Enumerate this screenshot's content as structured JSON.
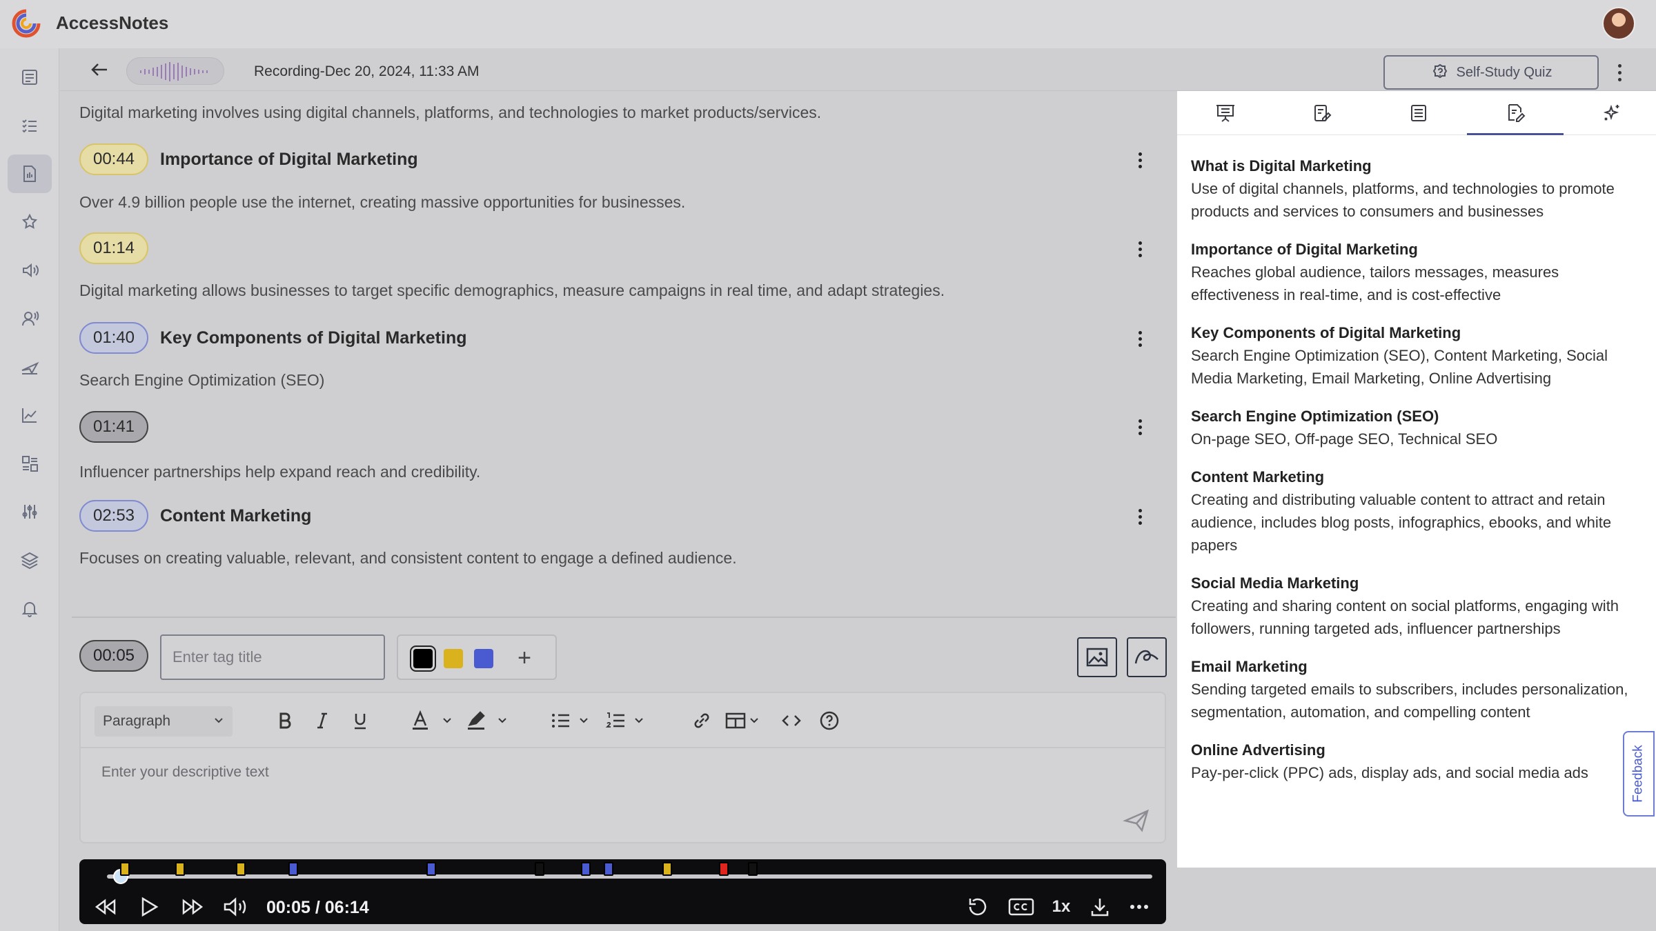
{
  "app": {
    "title": "AccessNotes"
  },
  "header": {
    "recording_title": "Recording-Dec 20, 2024, 11:33 AM",
    "quiz_button": "Self-Study Quiz"
  },
  "rail": {
    "items": [
      "notes-icon",
      "checklist-icon",
      "document-audio-icon",
      "star-icon",
      "speaker-icon",
      "voice-icon",
      "paper-plane-icon",
      "chart-line-icon",
      "layout-icon",
      "sliders-icon",
      "layers-icon",
      "bell-icon"
    ],
    "active_index": 2
  },
  "transcript": {
    "intro": "Digital marketing involves using digital channels, platforms, and technologies to market products/services.",
    "segments": [
      {
        "time": "00:44",
        "color": "yellow",
        "heading": "Importance of Digital Marketing",
        "text": "Over 4.9 billion people use the internet, creating massive opportunities for businesses."
      },
      {
        "time": "01:14",
        "color": "yellow",
        "heading": "",
        "text": "Digital marketing allows businesses to target specific demographics, measure campaigns in real time, and adapt strategies."
      },
      {
        "time": "01:40",
        "color": "blue",
        "heading": "Key Components of Digital Marketing",
        "text": "Search Engine Optimization (SEO)"
      },
      {
        "time": "01:41",
        "color": "dark",
        "heading": "",
        "text": "Influencer partnerships help expand reach and credibility."
      },
      {
        "time": "02:53",
        "color": "blue",
        "heading": "Content Marketing",
        "text": "Focuses on creating valuable, relevant, and consistent content to engage a defined audience."
      }
    ]
  },
  "tag": {
    "time": "00:05",
    "placeholder": "Enter tag title",
    "colors": [
      "#000000",
      "#d9b21d",
      "#4a5bd1"
    ],
    "add_label": "+"
  },
  "editor": {
    "paragraph_label": "Paragraph",
    "placeholder": "Enter your descriptive text"
  },
  "player": {
    "current": "00:05",
    "total": "06:14",
    "time_label": "00:05 / 06:14",
    "speed": "1x",
    "progress": 0.013,
    "markers": [
      {
        "pos": 0.017,
        "color": "#d9b21d"
      },
      {
        "pos": 0.07,
        "color": "#d9b21d"
      },
      {
        "pos": 0.128,
        "color": "#d9b21d"
      },
      {
        "pos": 0.178,
        "color": "#4a5bd1"
      },
      {
        "pos": 0.31,
        "color": "#4a5bd1"
      },
      {
        "pos": 0.414,
        "color": "#111111"
      },
      {
        "pos": 0.458,
        "color": "#4a5bd1"
      },
      {
        "pos": 0.48,
        "color": "#4a5bd1"
      },
      {
        "pos": 0.536,
        "color": "#d9b21d"
      },
      {
        "pos": 0.59,
        "color": "#e0251f"
      },
      {
        "pos": 0.618,
        "color": "#111111"
      }
    ]
  },
  "right_panel": {
    "tabs": [
      "presentation-icon",
      "document-edit-icon",
      "list-icon",
      "summary-edit-icon",
      "sparkle-icon"
    ],
    "active_tab": 3,
    "notes": [
      {
        "title": "What is Digital Marketing",
        "body": "Use of digital channels, platforms, and technologies to promote products and services to consumers and businesses"
      },
      {
        "title": "Importance of Digital Marketing",
        "body": "Reaches global audience, tailors messages, measures effectiveness in real-time, and is cost-effective"
      },
      {
        "title": "Key Components of Digital Marketing",
        "body": "Search Engine Optimization (SEO), Content Marketing, Social Media Marketing, Email Marketing, Online Advertising"
      },
      {
        "title": "Search Engine Optimization (SEO)",
        "body": "On-page SEO, Off-page SEO, Technical SEO"
      },
      {
        "title": "Content Marketing",
        "body": "Creating and distributing valuable content to attract and retain audience, includes blog posts, infographics, ebooks, and white papers"
      },
      {
        "title": "Social Media Marketing",
        "body": "Creating and sharing content on social platforms, engaging with followers, running targeted ads, influencer partnerships"
      },
      {
        "title": "Email Marketing",
        "body": "Sending targeted emails to subscribers, includes personalization, segmentation, automation, and compelling content"
      },
      {
        "title": "Online Advertising",
        "body": "Pay-per-click (PPC) ads, display ads, and social media ads"
      }
    ],
    "feedback_label": "Feedback"
  }
}
